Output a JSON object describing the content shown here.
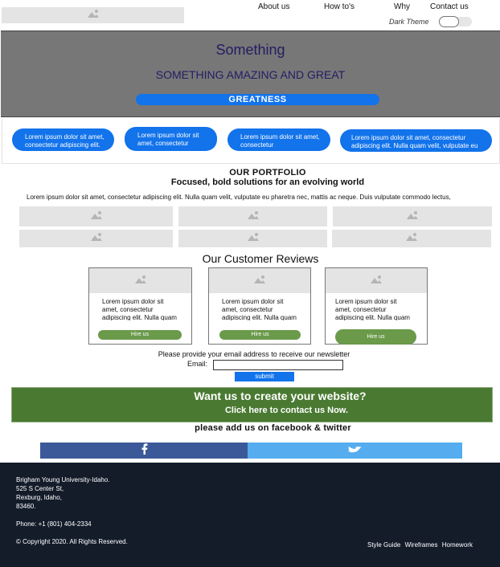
{
  "nav": {
    "links": [
      "About us",
      "How to's",
      "Why",
      "Contact us"
    ],
    "dark_theme_label": "Dark Theme"
  },
  "hero": {
    "title": "Something",
    "subtitle": "SOMETHING AMAZING AND GREAT",
    "cta_label": "GREATNESS"
  },
  "features": [
    "Lorem ipsum dolor sit amet, consectetur adipiscing elit.",
    "Lorem ipsum dolor sit amet, consectetur",
    "Lorem ipsum dolor sit amet, consectetur",
    "Lorem ipsum dolor sit amet, consectetur adipiscing elit. Nulla quam velit, vulputate eu"
  ],
  "portfolio": {
    "heading": "OUR PORTFOLIO",
    "subheading": "Focused, bold solutions for an evolving world",
    "intro": "Lorem ipsum dolor sit amet, consectetur adipiscing elit. Nulla quam velit, vulputate eu pharetra nec, mattis ac neque. Duis vulputate commodo lectus,"
  },
  "reviews": {
    "heading": "Our Customer Reviews",
    "cards": [
      {
        "text": "Lorem ipsum dolor sit amet, consectetur adipiscing elit. Nulla quam",
        "button": "Hire us"
      },
      {
        "text": "Lorem ipsum dolor sit amet, consectetur adipiscing elit. Nulla quam",
        "button": "Hire us"
      },
      {
        "text": "Lorem ipsum dolor sit amet, consectetur adipiscing elit. Nulla quam",
        "button": "Hire us"
      }
    ]
  },
  "newsletter": {
    "prompt": "Please provide your email address to receive our newsletter",
    "email_label": "Email:",
    "email_value": "",
    "submit_label": "submit"
  },
  "banner": {
    "title": "Want us to create your website?",
    "subtitle": "Click here to contact us Now."
  },
  "social": {
    "prompt": "please add us on facebook & twitter",
    "facebook_color": "#3b5998",
    "twitter_color": "#55acee"
  },
  "footer": {
    "address": [
      "Brigham Young University-Idaho.",
      "525 S Center St,",
      "Rexburg, Idaho,",
      "83460."
    ],
    "phone": "Phone: +1 (801) 404-2334",
    "copyright": "© Copyright 2020. All Rights Reserved.",
    "links": [
      "Style Guide",
      "Wireframes",
      "Homework"
    ]
  },
  "colors": {
    "accent_blue": "#1273eb",
    "banner_green": "#4a7a32",
    "button_green": "#6a9a4a",
    "hero_gray": "#777777",
    "footer_navy": "#141c2a"
  }
}
